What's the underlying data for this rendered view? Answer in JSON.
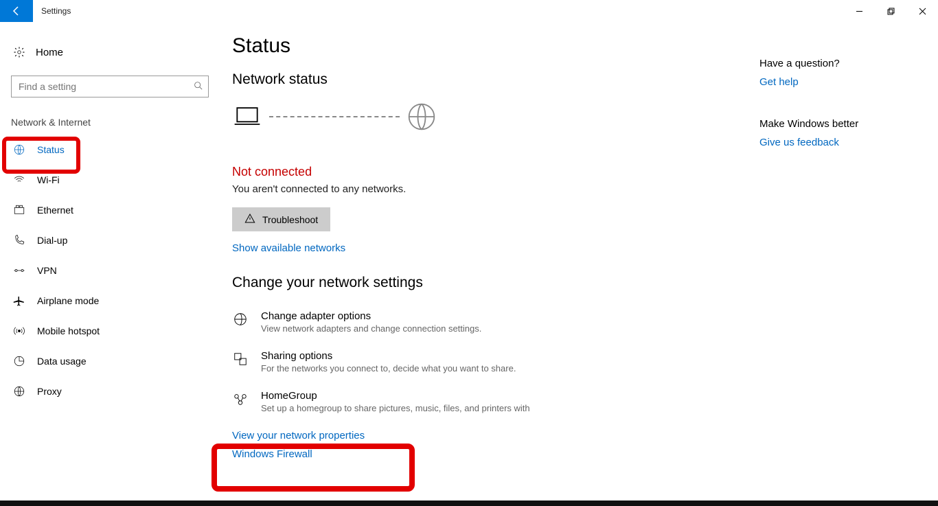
{
  "app": {
    "title": "Settings"
  },
  "search": {
    "placeholder": "Find a setting"
  },
  "sidebar": {
    "home": "Home",
    "section": "Network & Internet",
    "items": [
      {
        "label": "Status",
        "icon": "status-icon",
        "active": true
      },
      {
        "label": "Wi-Fi",
        "icon": "wifi-icon"
      },
      {
        "label": "Ethernet",
        "icon": "ethernet-icon"
      },
      {
        "label": "Dial-up",
        "icon": "dialup-icon"
      },
      {
        "label": "VPN",
        "icon": "vpn-icon"
      },
      {
        "label": "Airplane mode",
        "icon": "airplane-icon"
      },
      {
        "label": "Mobile hotspot",
        "icon": "hotspot-icon"
      },
      {
        "label": "Data usage",
        "icon": "datausage-icon"
      },
      {
        "label": "Proxy",
        "icon": "proxy-icon"
      }
    ]
  },
  "main": {
    "page_title": "Status",
    "network_status_heading": "Network status",
    "connection": {
      "title": "Not connected",
      "desc": "You aren't connected to any networks."
    },
    "troubleshoot": "Troubleshoot",
    "show_networks": "Show available networks",
    "change_heading": "Change your network settings",
    "rows": [
      {
        "title": "Change adapter options",
        "desc": "View network adapters and change connection settings.",
        "icon": "adapter-icon"
      },
      {
        "title": "Sharing options",
        "desc": "For the networks you connect to, decide what you want to share.",
        "icon": "sharing-icon"
      },
      {
        "title": "HomeGroup",
        "desc": "Set up a homegroup to share pictures, music, files, and printers with",
        "icon": "homegroup-icon"
      }
    ],
    "links": {
      "view_properties": "View your network properties",
      "firewall": "Windows Firewall"
    }
  },
  "right": {
    "q_head": "Have a question?",
    "q_link": "Get help",
    "fb_head": "Make Windows better",
    "fb_link": "Give us feedback"
  }
}
